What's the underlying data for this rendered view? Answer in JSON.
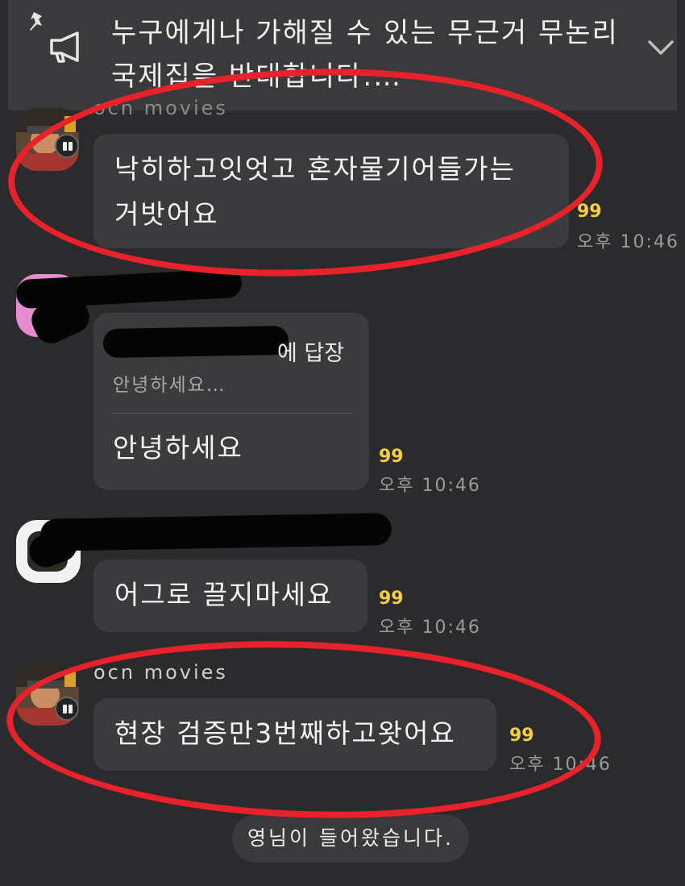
{
  "notice": {
    "text": "누구에게나 가해질 수 있는 무근거 무논리 국제집을 반대합니다.…",
    "pin_icon": "pin-icon",
    "megaphone_icon": "megaphone-icon",
    "expand_icon": "chevron-down-icon"
  },
  "messages": [
    {
      "sender": "ocn movies",
      "text": "낙히하고잇엇고 혼자물기어들가는 거밧어요",
      "unread": "99",
      "time": "오후 10:46"
    },
    {
      "reply_to_label": "에 답장",
      "reply_quote": "안녕하세요…",
      "text": "안녕하세요",
      "unread": "99",
      "time": "오후 10:46"
    },
    {
      "text": "어그로 끌지마세요",
      "unread": "99",
      "time": "오후 10:46"
    },
    {
      "sender": "ocn movies",
      "text": "현장 검증만3번째하고왓어요",
      "unread": "99",
      "time": "오후 10:46"
    }
  ],
  "system_message": "영님이 들어왔습니다.",
  "colors": {
    "background": "#2b2b2d",
    "bubble": "#3b3b3d",
    "unread": "#f4d03f",
    "annotation_ring": "#e8222b"
  }
}
